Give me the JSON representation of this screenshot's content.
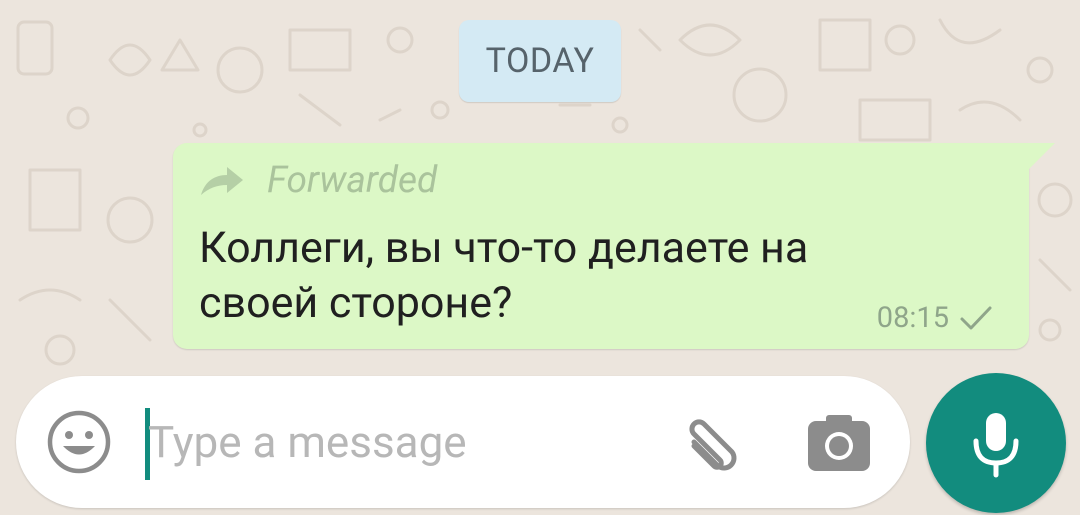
{
  "date_chip": {
    "label": "TODAY"
  },
  "message": {
    "forwarded_label": "Forwarded",
    "text": "Коллеги, вы что-то делаете на своей стороне?",
    "time": "08:15",
    "status_icon": "check-icon"
  },
  "composer": {
    "placeholder": "Type a message",
    "value": "",
    "emoji_icon": "emoji-icon",
    "attach_icon": "paperclip-icon",
    "camera_icon": "camera-icon",
    "mic_icon": "mic-icon"
  },
  "colors": {
    "wallpaper": "#ECE5DD",
    "outgoing_bubble": "#DCF8C6",
    "date_chip": "#D4EAF4",
    "accent": "#128C7E"
  }
}
